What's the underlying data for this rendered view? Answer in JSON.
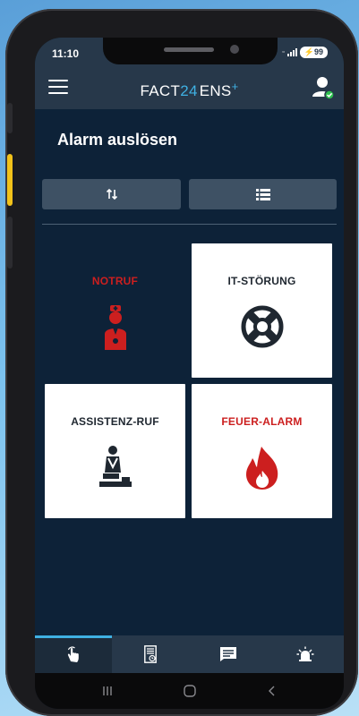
{
  "status_bar": {
    "time": "11:10",
    "battery": "99"
  },
  "app_bar": {
    "logo_main": "FACT",
    "logo_num": "24",
    "logo_ens": "ENS",
    "logo_plus": "+"
  },
  "page": {
    "title": "Alarm auslösen"
  },
  "tiles": [
    {
      "label": "NOTRUF",
      "label_color": "#cc1f1f",
      "icon": "nurse-icon"
    },
    {
      "label": "IT-STÖRUNG",
      "label_color": "#1f2730",
      "icon": "lifebuoy-icon"
    },
    {
      "label": "ASSISTENZ-RUF",
      "label_color": "#1f2730",
      "icon": "cpr-icon"
    },
    {
      "label": "FEUER-ALARM",
      "label_color": "#cc1f1f",
      "icon": "fire-icon"
    }
  ],
  "bottom_nav": [
    {
      "icon": "touch-hand-icon",
      "active": true
    },
    {
      "icon": "document-clock-icon",
      "active": false
    },
    {
      "icon": "chat-icon",
      "active": false
    },
    {
      "icon": "alarm-bell-icon",
      "active": false
    }
  ],
  "colors": {
    "accent": "#3fb1e3",
    "alarm_red": "#cc1f1f",
    "background": "#0d2238",
    "bar": "#27384a"
  }
}
